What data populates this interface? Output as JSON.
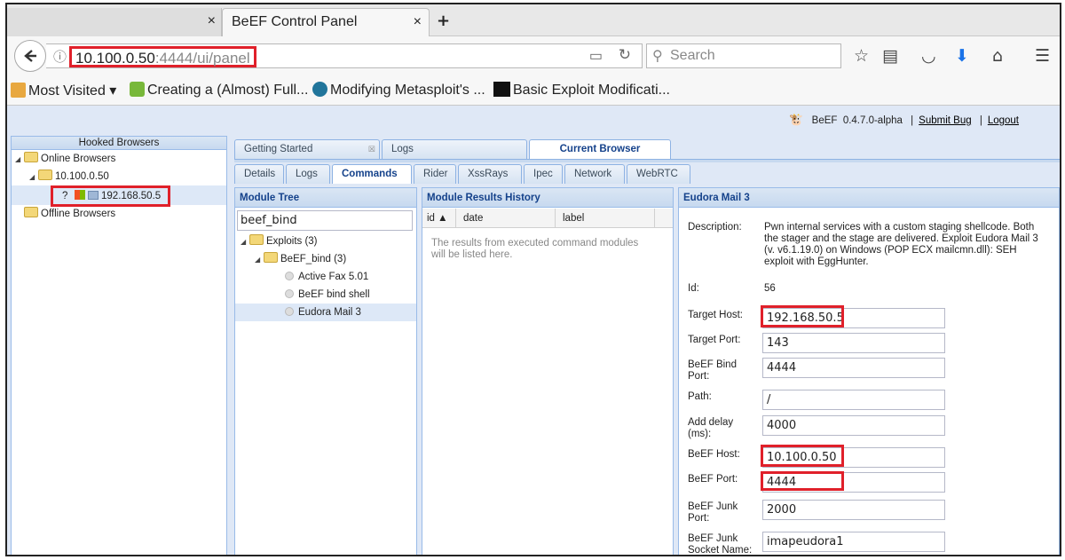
{
  "browser": {
    "tabs": [
      {
        "label": "",
        "close": "×"
      },
      {
        "label": "BeEF Control Panel",
        "close": "×"
      }
    ],
    "new_tab": "+",
    "url_host": "10.100.0.50",
    "url_rest": ":4444/ui/panel",
    "search_placeholder": "Search",
    "bookmarks": [
      {
        "label": "Most Visited ▾",
        "icon": "most-visited-icon"
      },
      {
        "label": "Creating a (Almost) Full...",
        "icon": "page-icon"
      },
      {
        "label": "Modifying Metasploit's ...",
        "icon": "wordpress-icon"
      },
      {
        "label": "Basic Exploit Modificati...",
        "icon": "dh-icon"
      }
    ]
  },
  "beef": {
    "header": {
      "app": "BeEF",
      "version": "0.4.7.0-alpha",
      "submit_bug": "Submit Bug",
      "logout": "Logout"
    },
    "hooked": {
      "title": "Hooked Browsers",
      "online": "Online Browsers",
      "host": "10.100.0.50",
      "victim": "192.168.50.5",
      "offline": "Offline Browsers"
    },
    "main_tabs": [
      "Getting Started",
      "Logs",
      "Current Browser"
    ],
    "sub_tabs": [
      "Details",
      "Logs",
      "Commands",
      "Rider",
      "XssRays",
      "Ipec",
      "Network",
      "WebRTC"
    ],
    "module_tree": {
      "title": "Module Tree",
      "search": "beef_bind",
      "nodes": [
        "Exploits (3)",
        "BeEF_bind (3)",
        "Active Fax 5.01",
        "BeEF bind shell",
        "Eudora Mail 3"
      ]
    },
    "results": {
      "title": "Module Results History",
      "columns": [
        "id ▲",
        "date",
        "label"
      ],
      "empty": "The results from executed command modules will be listed here."
    },
    "module": {
      "title": "Eudora Mail 3",
      "description_label": "Description:",
      "description": "Pwn internal services with a custom staging shellcode. Both the stager and the stage are delivered. Exploit Eudora Mail 3 (v. v6.1.19.0) on Windows (POP ECX mailcmn.dll): SEH exploit with EggHunter.",
      "id_label": "Id:",
      "id": "56",
      "fields": [
        {
          "label": "Target Host:",
          "value": "192.168.50.5"
        },
        {
          "label": "Target Port:",
          "value": "143"
        },
        {
          "label": "BeEF Bind Port:",
          "value": "4444"
        },
        {
          "label": "Path:",
          "value": "/"
        },
        {
          "label": "Add delay (ms):",
          "value": "4000"
        },
        {
          "label": "BeEF Host:",
          "value": "10.100.0.50"
        },
        {
          "label": "BeEF Port:",
          "value": "4444"
        },
        {
          "label": "BeEF Junk Port:",
          "value": "2000"
        },
        {
          "label": "BeEF Junk Socket Name:",
          "value": "imapeudora1"
        }
      ]
    }
  },
  "colors": {
    "highlight": "#e0202a",
    "panel_border": "#99bbe8",
    "header_text": "#15428b"
  }
}
